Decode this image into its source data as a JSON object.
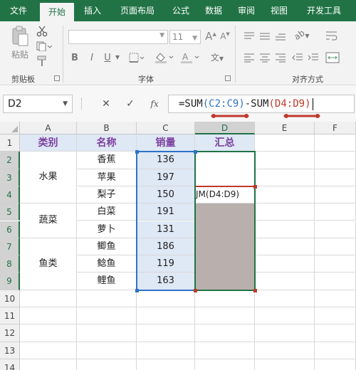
{
  "tabs": [
    "文件",
    "开始",
    "插入",
    "页面布局",
    "公式",
    "数据",
    "审阅",
    "视图",
    "开发工具"
  ],
  "ribbon": {
    "groups": [
      "剪贴板",
      "字体",
      "对齐方式"
    ],
    "paste_label": "粘贴",
    "font_size": "11",
    "bold_label": "B",
    "italic_label": "I",
    "underline_label": "U",
    "font_grow": "A",
    "font_shrink": "A",
    "wen_label": "文"
  },
  "formula_bar": {
    "name_box": "D2",
    "fx_label": "fx",
    "formula_parts": [
      {
        "text": "=SUM",
        "style": "plain"
      },
      {
        "text": "(",
        "style": "paren-blue"
      },
      {
        "text": "C2:C9",
        "style": "ref-blue"
      },
      {
        "text": ")",
        "style": "paren-blue"
      },
      {
        "text": "-SUM",
        "style": "plain"
      },
      {
        "text": "(",
        "style": "paren-red"
      },
      {
        "text": "D4:D9",
        "style": "ref-red"
      },
      {
        "text": ")",
        "style": "paren-red"
      }
    ]
  },
  "columns": [
    "A",
    "B",
    "C",
    "D",
    "E",
    "F"
  ],
  "rows": [
    "1",
    "2",
    "3",
    "4",
    "5",
    "6",
    "7",
    "8",
    "9",
    "10",
    "11",
    "12",
    "13",
    "14"
  ],
  "sheet": {
    "headers": [
      "类别",
      "名称",
      "销量",
      "汇总"
    ],
    "categories": [
      "水果",
      "蔬菜",
      "鱼类"
    ],
    "names": [
      "香蕉",
      "苹果",
      "梨子",
      "白菜",
      "萝卜",
      "鲫鱼",
      "鲶鱼",
      "鲤鱼"
    ],
    "sales": [
      "136",
      "197",
      "150",
      "191",
      "131",
      "186",
      "119",
      "163"
    ],
    "d4_spill": "JM(D4:D9)"
  },
  "colors": {
    "accent": "#217346",
    "blue_ref": "#2c72c7",
    "red_ref": "#c0392b",
    "header_fill": "#dfe8f5",
    "header_text": "#7b3f9e",
    "grey_fill": "#b9b0ae"
  }
}
